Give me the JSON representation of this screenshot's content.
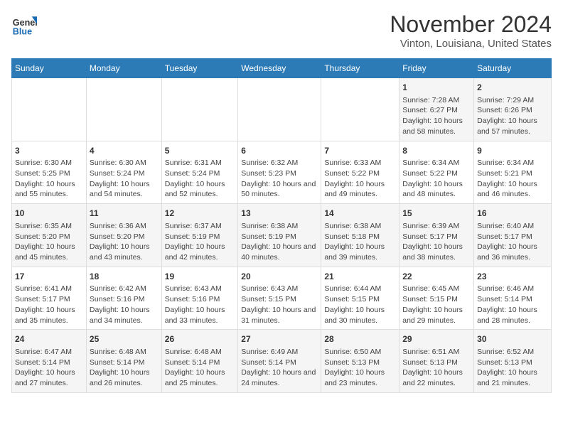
{
  "header": {
    "logo_general": "General",
    "logo_blue": "Blue",
    "title": "November 2024",
    "subtitle": "Vinton, Louisiana, United States"
  },
  "days_of_week": [
    "Sunday",
    "Monday",
    "Tuesday",
    "Wednesday",
    "Thursday",
    "Friday",
    "Saturday"
  ],
  "weeks": [
    [
      {
        "day": "",
        "info": ""
      },
      {
        "day": "",
        "info": ""
      },
      {
        "day": "",
        "info": ""
      },
      {
        "day": "",
        "info": ""
      },
      {
        "day": "",
        "info": ""
      },
      {
        "day": "1",
        "info": "Sunrise: 7:28 AM\nSunset: 6:27 PM\nDaylight: 10 hours and 58 minutes."
      },
      {
        "day": "2",
        "info": "Sunrise: 7:29 AM\nSunset: 6:26 PM\nDaylight: 10 hours and 57 minutes."
      }
    ],
    [
      {
        "day": "3",
        "info": "Sunrise: 6:30 AM\nSunset: 5:25 PM\nDaylight: 10 hours and 55 minutes."
      },
      {
        "day": "4",
        "info": "Sunrise: 6:30 AM\nSunset: 5:24 PM\nDaylight: 10 hours and 54 minutes."
      },
      {
        "day": "5",
        "info": "Sunrise: 6:31 AM\nSunset: 5:24 PM\nDaylight: 10 hours and 52 minutes."
      },
      {
        "day": "6",
        "info": "Sunrise: 6:32 AM\nSunset: 5:23 PM\nDaylight: 10 hours and 50 minutes."
      },
      {
        "day": "7",
        "info": "Sunrise: 6:33 AM\nSunset: 5:22 PM\nDaylight: 10 hours and 49 minutes."
      },
      {
        "day": "8",
        "info": "Sunrise: 6:34 AM\nSunset: 5:22 PM\nDaylight: 10 hours and 48 minutes."
      },
      {
        "day": "9",
        "info": "Sunrise: 6:34 AM\nSunset: 5:21 PM\nDaylight: 10 hours and 46 minutes."
      }
    ],
    [
      {
        "day": "10",
        "info": "Sunrise: 6:35 AM\nSunset: 5:20 PM\nDaylight: 10 hours and 45 minutes."
      },
      {
        "day": "11",
        "info": "Sunrise: 6:36 AM\nSunset: 5:20 PM\nDaylight: 10 hours and 43 minutes."
      },
      {
        "day": "12",
        "info": "Sunrise: 6:37 AM\nSunset: 5:19 PM\nDaylight: 10 hours and 42 minutes."
      },
      {
        "day": "13",
        "info": "Sunrise: 6:38 AM\nSunset: 5:19 PM\nDaylight: 10 hours and 40 minutes."
      },
      {
        "day": "14",
        "info": "Sunrise: 6:38 AM\nSunset: 5:18 PM\nDaylight: 10 hours and 39 minutes."
      },
      {
        "day": "15",
        "info": "Sunrise: 6:39 AM\nSunset: 5:17 PM\nDaylight: 10 hours and 38 minutes."
      },
      {
        "day": "16",
        "info": "Sunrise: 6:40 AM\nSunset: 5:17 PM\nDaylight: 10 hours and 36 minutes."
      }
    ],
    [
      {
        "day": "17",
        "info": "Sunrise: 6:41 AM\nSunset: 5:17 PM\nDaylight: 10 hours and 35 minutes."
      },
      {
        "day": "18",
        "info": "Sunrise: 6:42 AM\nSunset: 5:16 PM\nDaylight: 10 hours and 34 minutes."
      },
      {
        "day": "19",
        "info": "Sunrise: 6:43 AM\nSunset: 5:16 PM\nDaylight: 10 hours and 33 minutes."
      },
      {
        "day": "20",
        "info": "Sunrise: 6:43 AM\nSunset: 5:15 PM\nDaylight: 10 hours and 31 minutes."
      },
      {
        "day": "21",
        "info": "Sunrise: 6:44 AM\nSunset: 5:15 PM\nDaylight: 10 hours and 30 minutes."
      },
      {
        "day": "22",
        "info": "Sunrise: 6:45 AM\nSunset: 5:15 PM\nDaylight: 10 hours and 29 minutes."
      },
      {
        "day": "23",
        "info": "Sunrise: 6:46 AM\nSunset: 5:14 PM\nDaylight: 10 hours and 28 minutes."
      }
    ],
    [
      {
        "day": "24",
        "info": "Sunrise: 6:47 AM\nSunset: 5:14 PM\nDaylight: 10 hours and 27 minutes."
      },
      {
        "day": "25",
        "info": "Sunrise: 6:48 AM\nSunset: 5:14 PM\nDaylight: 10 hours and 26 minutes."
      },
      {
        "day": "26",
        "info": "Sunrise: 6:48 AM\nSunset: 5:14 PM\nDaylight: 10 hours and 25 minutes."
      },
      {
        "day": "27",
        "info": "Sunrise: 6:49 AM\nSunset: 5:14 PM\nDaylight: 10 hours and 24 minutes."
      },
      {
        "day": "28",
        "info": "Sunrise: 6:50 AM\nSunset: 5:13 PM\nDaylight: 10 hours and 23 minutes."
      },
      {
        "day": "29",
        "info": "Sunrise: 6:51 AM\nSunset: 5:13 PM\nDaylight: 10 hours and 22 minutes."
      },
      {
        "day": "30",
        "info": "Sunrise: 6:52 AM\nSunset: 5:13 PM\nDaylight: 10 hours and 21 minutes."
      }
    ]
  ]
}
